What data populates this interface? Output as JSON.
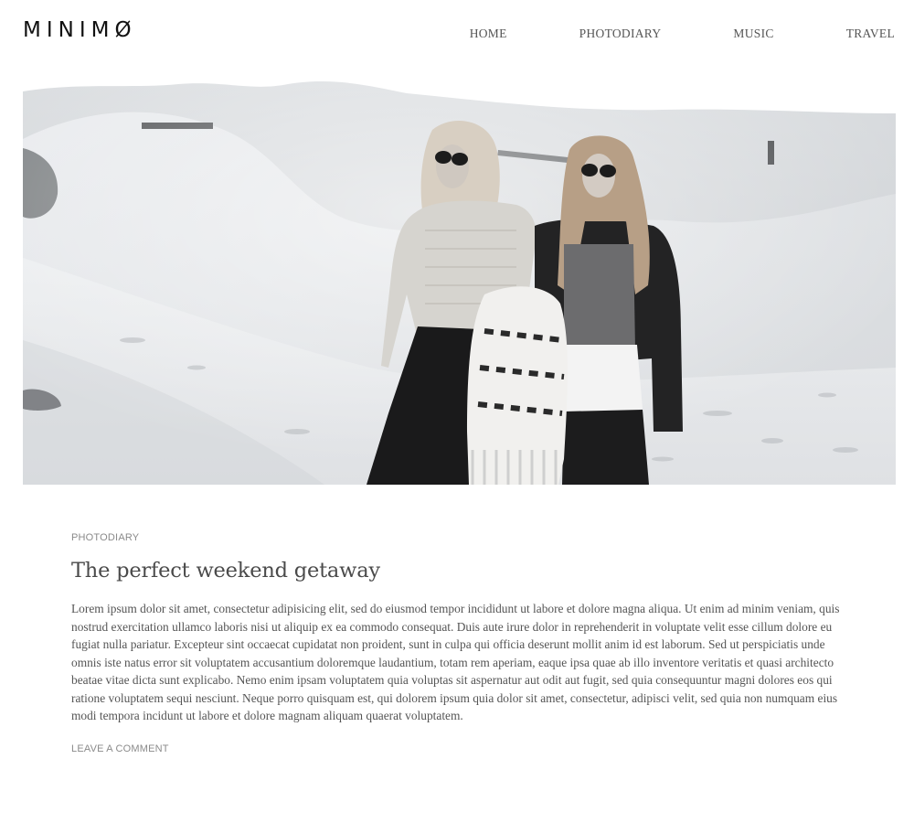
{
  "site": {
    "logo": "MINIMØ"
  },
  "nav": {
    "items": [
      {
        "label": "HOME"
      },
      {
        "label": "PHOTODIARY"
      },
      {
        "label": "MUSIC"
      },
      {
        "label": "TRAVEL"
      }
    ]
  },
  "hero": {
    "image": "black-and-white photo of two women in sunglasses standing on sand dunes"
  },
  "post": {
    "category": "PHOTODIARY",
    "title": "The perfect weekend getaway",
    "body": "Lorem ipsum dolor sit amet, consectetur adipisicing elit, sed do eiusmod tempor incididunt ut labore et dolore magna aliqua. Ut enim ad minim veniam, quis nostrud exercitation ullamco laboris nisi ut aliquip ex ea commodo consequat. Duis aute irure dolor in reprehenderit in voluptate velit esse cillum dolore eu fugiat nulla pariatur. Excepteur sint occaecat cupidatat non proident, sunt in culpa qui officia deserunt mollit anim id est laborum. Sed ut perspiciatis unde omnis iste natus error sit voluptatem accusantium doloremque laudantium, totam rem aperiam, eaque ipsa quae ab illo inventore veritatis et quasi architecto beatae vitae dicta sunt explicabo. Nemo enim ipsam voluptatem quia voluptas sit aspernatur aut odit aut fugit, sed quia consequuntur magni dolores eos qui ratione voluptatem sequi nesciunt. Neque porro quisquam est, qui dolorem ipsum quia dolor sit amet, consectetur, adipisci velit, sed quia non numquam eius modi tempora incidunt ut labore et dolore magnam aliquam quaerat voluptatem.",
    "comment_link": "LEAVE A COMMENT"
  }
}
